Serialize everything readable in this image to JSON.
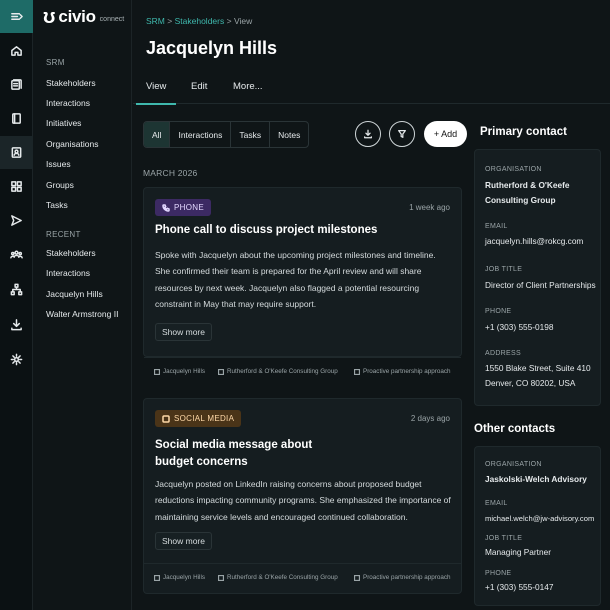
{
  "brand": {
    "name": "civio",
    "suffix": "connect"
  },
  "rail_icons": [
    "menu-icon",
    "home-icon",
    "layers-icon",
    "book-icon",
    "contact-card-icon",
    "grid-icon",
    "send-icon",
    "people-icon",
    "org-chart-icon",
    "download-icon",
    "gear-icon"
  ],
  "sidebar": {
    "section1": "SRM",
    "items": [
      "Stakeholders",
      "Interactions",
      "Initiatives",
      "Organisations",
      "Issues",
      "Groups",
      "Tasks"
    ],
    "section2": "RECENT",
    "recent": [
      "Stakeholders",
      "Interactions",
      "Jacquelyn Hills",
      "Walter Armstrong II"
    ]
  },
  "breadcrumb": {
    "a": "SRM",
    "sep1": ">",
    "b": "Stakeholders",
    "sep2": ">",
    "c": "View"
  },
  "page_title": "Jacquelyn Hills",
  "tabs": [
    "View",
    "Edit",
    "More..."
  ],
  "filters": [
    "All",
    "Interactions",
    "Tasks",
    "Notes"
  ],
  "add_label": "+ Add",
  "month_label": "MARCH 2026",
  "cards": [
    {
      "badge": "PHONE",
      "ago": "1 week ago",
      "title": "Phone call to discuss project milestones",
      "body": "Spoke with Jacquelyn about the upcoming project milestones and timeline. She confirmed their team is prepared for the April review and will share resources by next week. Jacquelyn also flagged a potential resourcing constraint in May that may require support.",
      "more": "Show more",
      "meta": [
        "Jacquelyn Hills",
        "Rutherford & O'Keefe Consulting Group",
        "Proactive partnership approach"
      ]
    },
    {
      "badge": "SOCIAL MEDIA",
      "ago": "2 days ago",
      "title": "Social media message about budget concerns",
      "body": "Jacquelyn posted on LinkedIn raising concerns about proposed budget reductions impacting community programs. She emphasized the importance of maintaining service levels and encouraged continued collaboration.",
      "more": "Show more",
      "meta": [
        "Jacquelyn Hills",
        "Rutherford & O'Keefe Consulting Group",
        "Proactive partnership approach"
      ]
    }
  ],
  "primary_contact": {
    "heading": "Primary contact",
    "org_label": "ORGANISATION",
    "org": "Rutherford & O'Keefe Consulting Group",
    "email_label": "EMAIL",
    "email": "jacquelyn.hills@rokcg.com",
    "job_label": "JOB TITLE",
    "job": "Director of Client Partnerships",
    "phone_label": "PHONE",
    "phone": "+1 (303) 555-0198",
    "address_label": "ADDRESS",
    "address": "1550 Blake Street, Suite 410 Denver, CO 80202, USA"
  },
  "other_contacts": {
    "heading": "Other contacts",
    "org_label": "ORGANISATION",
    "org": "Jaskolski-Welch Advisory",
    "email_label": "EMAIL",
    "email": "michael.welch@jw-advisory.com",
    "job_label": "JOB TITLE",
    "job": "Managing Partner",
    "phone_label": "PHONE",
    "phone": "+1 (303) 555-0147"
  },
  "colors": {
    "accent": "#3fb8ad",
    "background": "#0f1517",
    "card": "#151d20",
    "phone_badge": "#3c2a63",
    "social_badge": "#4a3418"
  }
}
